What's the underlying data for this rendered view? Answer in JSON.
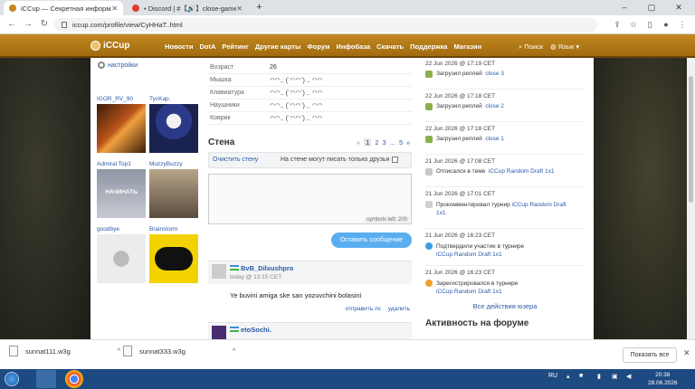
{
  "browser": {
    "tabs": [
      {
        "title": "iCCup — Секретная информаци",
        "active": true
      },
      {
        "title": "• Discord | #【🔊】close-games",
        "active": false
      }
    ],
    "url": "iccup.com/profile/view/CyHHaT..html"
  },
  "site_nav": {
    "logo": "iCCup",
    "links": [
      "Новости",
      "DotA",
      "Рейтинг",
      "Другие карты",
      "Форум",
      "Инфобаза",
      "Скачать",
      "Поддержка",
      "Магазин"
    ],
    "search": "Поиск",
    "language": "Язык"
  },
  "profile": {
    "settings_label": "настройки",
    "friends": [
      {
        "name": "IGOR_RV_90"
      },
      {
        "name": "TycKap."
      },
      {
        "name": "Admiral Top1"
      },
      {
        "name": "MuzzyBuzzy"
      },
      {
        "name": "goodbye"
      },
      {
        "name": "Brainstorm"
      }
    ],
    "friend_image_text": {
      "admiral": "НАЧИНАТЬ"
    },
    "stats": [
      {
        "label": "Возраст",
        "value": "26"
      },
      {
        "label": "Мышка",
        "value": "ᐟᐠᐟᐠ.. (`ᐟᐠᐟᐠ`) .. ᐟᐠᐟᐠ"
      },
      {
        "label": "Клавиатура",
        "value": "ᐟᐠᐟᐠ.. (`ᐟᐠᐟᐠ`) .. ᐟᐠᐟᐠ"
      },
      {
        "label": "Наушники",
        "value": "ᐟᐠᐟᐠ.. (`ᐟᐠᐟᐠ`) .. ᐟᐠᐟᐠ"
      },
      {
        "label": "Коврик",
        "value": "ᐟᐠᐟᐠ.. (`ᐟᐠᐟᐠ`) .. ᐟᐠᐟᐠ"
      }
    ]
  },
  "wall": {
    "title": "Стена",
    "pager": [
      "1",
      "2",
      "3",
      "...",
      "5",
      "»"
    ],
    "clear_label": "Очистить стену",
    "friends_only_label": "На стене могут писать только друзья",
    "symbols_left": "symbols left: 200",
    "post_button": "Оставить сообщение",
    "posts": [
      {
        "author": "BvB_Dilxushpro",
        "date": "today @ 13:15 CET",
        "text": "Ye buvini amiga ske san yozuvchini bolasini",
        "reply_label": "отправить лс",
        "delete_label": "удалить"
      },
      {
        "author": "etoSochi.",
        "date": "",
        "text": "",
        "reply_label": "",
        "delete_label": ""
      }
    ]
  },
  "activity": {
    "items": [
      {
        "date": "22 Jun 2026 @ 17:19 CET",
        "text": "Загрузил реплей",
        "link": "close 3",
        "type": "replay"
      },
      {
        "date": "22 Jun 2026 @ 17:18 CET",
        "text": "Загрузил реплей",
        "link": "close 2",
        "type": "replay"
      },
      {
        "date": "22 Jun 2026 @ 17:18 CET",
        "text": "Загрузил реплей",
        "link": "close 1",
        "type": "replay"
      },
      {
        "date": "21 Jun 2026 @ 17:08 CET",
        "text": "Отписался в теме",
        "link": "iCCup Random Draft 1x1",
        "type": "forum"
      },
      {
        "date": "21 Jun 2026 @ 17:01 CET",
        "text": "Прокомментировал турнир",
        "link": "iCCup Random Draft 1x1",
        "type": "comment"
      },
      {
        "date": "21 Jun 2026 @ 16:23 CET",
        "text": "Подтвердили участие в турнире",
        "link": "iCCup Random Draft 1x1",
        "type": "confirm"
      },
      {
        "date": "21 Jun 2026 @ 16:23 CET",
        "text": "Зарегистрировался в турнире",
        "link": "iCCup Random Draft 1x1",
        "type": "register"
      }
    ],
    "all_label": "Все действия юзера",
    "forum_title": "Активность на форуме"
  },
  "downloads": {
    "files": [
      "sunnat111.w3g",
      "sunnat333.w3g"
    ],
    "show_all": "Показать все"
  },
  "taskbar": {
    "lang": "RU",
    "time": "20:38",
    "date": "28.06.2026"
  },
  "colors": {
    "nav": "#b27a16",
    "link": "#2b5aa8",
    "button": "#5aaef0"
  }
}
